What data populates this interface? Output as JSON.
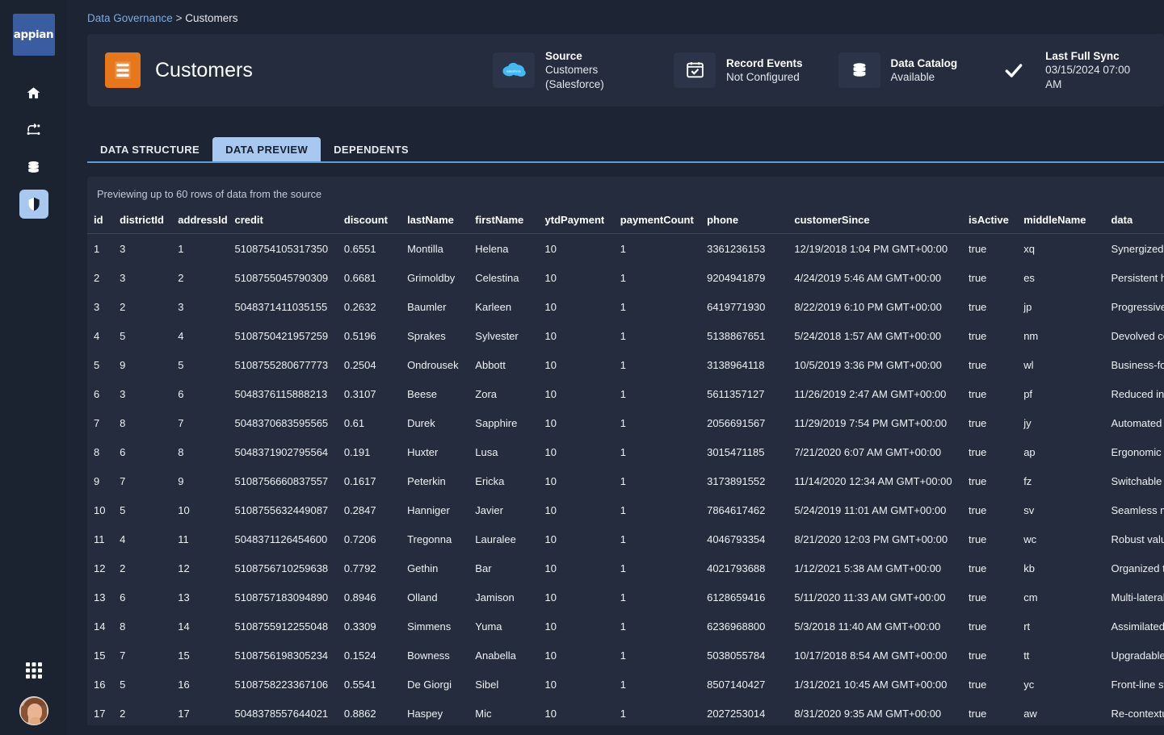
{
  "sidebar": {
    "logo_text": "appian",
    "items": [
      {
        "name": "home",
        "icon": "home-icon",
        "active": false
      },
      {
        "name": "process",
        "icon": "process-flow-icon",
        "active": false
      },
      {
        "name": "data",
        "icon": "database-icon",
        "active": false
      },
      {
        "name": "governance",
        "icon": "shield-icon",
        "active": true
      }
    ],
    "bottom": [
      {
        "name": "apps",
        "icon": "grid-apps-icon"
      },
      {
        "name": "profile",
        "icon": "user-avatar"
      }
    ]
  },
  "breadcrumb": {
    "parent": "Data Governance",
    "separator": ">",
    "current": "Customers"
  },
  "header": {
    "title": "Customers",
    "title_icon": "record-type-icon",
    "stats": [
      {
        "icon": "salesforce-cloud-icon",
        "label": "Source",
        "value": "Customers (Salesforce)"
      },
      {
        "icon": "calendar-check-icon",
        "label": "Record Events",
        "value": "Not Configured"
      },
      {
        "icon": "database-icon",
        "label": "Data Catalog",
        "value": "Available"
      },
      {
        "icon": "checkmark-icon",
        "label": "Last Full Sync",
        "value": "03/15/2024 07:00 AM"
      }
    ]
  },
  "tabs": [
    {
      "label": "DATA STRUCTURE",
      "active": false
    },
    {
      "label": "DATA PREVIEW",
      "active": true
    },
    {
      "label": "DEPENDENTS",
      "active": false
    }
  ],
  "preview": {
    "note": "Previewing up to 60 rows of data from the source",
    "columns": [
      "id",
      "districtId",
      "addressId",
      "credit",
      "discount",
      "lastName",
      "firstName",
      "ytdPayment",
      "paymentCount",
      "phone",
      "customerSince",
      "isActive",
      "middleName",
      "data"
    ],
    "rows": [
      [
        "1",
        "3",
        "1",
        "5108754105317350",
        "0.6551",
        "Montilla",
        "Helena",
        "10",
        "1",
        "3361236153",
        "12/19/2018 1:04 PM GMT+00:00",
        "true",
        "xq",
        "Synergized ne"
      ],
      [
        "2",
        "3",
        "2",
        "5108755045790309",
        "0.6681",
        "Grimoldby",
        "Celestina",
        "10",
        "1",
        "9204941879",
        "4/24/2019 5:46 AM GMT+00:00",
        "true",
        "es",
        "Persistent holi"
      ],
      [
        "3",
        "2",
        "3",
        "5048371411035155",
        "0.2632",
        "Baumler",
        "Karleen",
        "10",
        "1",
        "6419771930",
        "8/22/2019 6:10 PM GMT+00:00",
        "true",
        "jp",
        "Progressive as"
      ],
      [
        "4",
        "5",
        "4",
        "5108750421957259",
        "0.5196",
        "Sprakes",
        "Sylvester",
        "10",
        "1",
        "5138867651",
        "5/24/2018 1:57 AM GMT+00:00",
        "true",
        "nm",
        "Devolved com"
      ],
      [
        "5",
        "9",
        "5",
        "5108755280677773",
        "0.2504",
        "Ondrousek",
        "Abbott",
        "10",
        "1",
        "3138964118",
        "10/5/2019 3:36 PM GMT+00:00",
        "true",
        "wl",
        "Business-focus"
      ],
      [
        "6",
        "3",
        "6",
        "5048376115888213",
        "0.3107",
        "Beese",
        "Zora",
        "10",
        "1",
        "5611357127",
        "11/26/2019 2:47 AM GMT+00:00",
        "true",
        "pf",
        "Reduced intan"
      ],
      [
        "7",
        "8",
        "7",
        "5048370683595565",
        "0.61",
        "Durek",
        "Sapphire",
        "10",
        "1",
        "2056691567",
        "11/29/2019 7:54 PM GMT+00:00",
        "true",
        "jy",
        "Automated an"
      ],
      [
        "8",
        "6",
        "8",
        "5048371902795564",
        "0.191",
        "Huxter",
        "Lusa",
        "10",
        "1",
        "3015471185",
        "7/21/2020 6:07 AM GMT+00:00",
        "true",
        "ap",
        "Ergonomic inte"
      ],
      [
        "9",
        "7",
        "9",
        "5108756660837557",
        "0.1617",
        "Peterkin",
        "Ericka",
        "10",
        "1",
        "3173891552",
        "11/14/2020 12:34 AM GMT+00:00",
        "true",
        "fz",
        "Switchable de"
      ],
      [
        "10",
        "5",
        "10",
        "5108755632449087",
        "0.2847",
        "Hanniger",
        "Javier",
        "10",
        "1",
        "7864617462",
        "5/24/2019 11:01 AM GMT+00:00",
        "true",
        "sv",
        "Seamless max"
      ],
      [
        "11",
        "4",
        "11",
        "5048371126454600",
        "0.7206",
        "Tregonna",
        "Lauralee",
        "10",
        "1",
        "4046793354",
        "8/21/2020 12:03 PM GMT+00:00",
        "true",
        "wc",
        "Robust value-a"
      ],
      [
        "12",
        "2",
        "12",
        "5108756710259638",
        "0.7792",
        "Gethin",
        "Bar",
        "10",
        "1",
        "4021793688",
        "1/12/2021 5:38 AM GMT+00:00",
        "true",
        "kb",
        "Organized tan"
      ],
      [
        "13",
        "6",
        "13",
        "5108757183094890",
        "0.8946",
        "Olland",
        "Jamison",
        "10",
        "1",
        "6128659416",
        "5/11/2020 11:33 AM GMT+00:00",
        "true",
        "cm",
        "Multi-lateral fo"
      ],
      [
        "14",
        "8",
        "14",
        "5108755912255048",
        "0.3309",
        "Simmens",
        "Yuma",
        "10",
        "1",
        "6236968800",
        "5/3/2018 11:40 AM GMT+00:00",
        "true",
        "rt",
        "Assimilated hu"
      ],
      [
        "15",
        "7",
        "15",
        "5108756198305234",
        "0.1524",
        "Bowness",
        "Anabella",
        "10",
        "1",
        "5038055784",
        "10/17/2018 8:54 AM GMT+00:00",
        "true",
        "tt",
        "Upgradable as"
      ],
      [
        "16",
        "5",
        "16",
        "5108758223367106",
        "0.5541",
        "De Giorgi",
        "Sibel",
        "10",
        "1",
        "8507140427",
        "1/31/2021 10:45 AM GMT+00:00",
        "true",
        "yc",
        "Front-line stati"
      ],
      [
        "17",
        "2",
        "17",
        "5048378557644021",
        "0.8862",
        "Haspey",
        "Mic",
        "10",
        "1",
        "2027253014",
        "8/31/2020 9:35 AM GMT+00:00",
        "true",
        "aw",
        "Re-contextuali"
      ]
    ]
  },
  "colors": {
    "app_bg": "#1d2433",
    "sidebar_bg": "#1b2230",
    "panel_bg": "#242c3d",
    "accent_blue": "#5b9bd5",
    "tab_active_bg": "#a8c8f0",
    "logo_blue": "#3a5ca0",
    "title_icon_orange": "#e8761b",
    "link_blue": "#7fa9e0"
  }
}
